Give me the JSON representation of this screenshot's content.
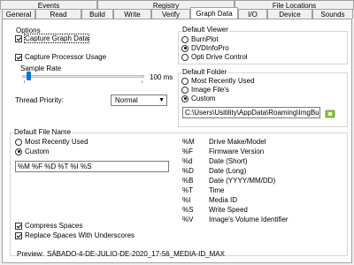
{
  "tabs_row1": [
    {
      "label": "Events"
    },
    {
      "label": "Registry"
    },
    {
      "label": "File Locations"
    }
  ],
  "tabs_row2": [
    {
      "label": "General"
    },
    {
      "label": "Read"
    },
    {
      "label": "Build"
    },
    {
      "label": "Write"
    },
    {
      "label": "Verify"
    },
    {
      "label": "Graph Data"
    },
    {
      "label": "I/O"
    },
    {
      "label": "Device"
    },
    {
      "label": "Sounds"
    }
  ],
  "options": {
    "title": "Options",
    "capture_graph_data": {
      "label": "Capture Graph Data",
      "checked": true
    },
    "capture_processor_usage": {
      "label": "Capture Processor Usage",
      "checked": true
    },
    "sample_rate_label": "Sample Rate",
    "sample_rate_value": "100 ms",
    "sample_rate_fraction": 0.04,
    "thread_priority_label": "Thread Priority:",
    "thread_priority_value": "Normal"
  },
  "default_viewer": {
    "title": "Default Viewer",
    "items": [
      {
        "label": "BurnPlot",
        "checked": false
      },
      {
        "label": "DVDInfoPro",
        "checked": true
      },
      {
        "label": "Opti Drive Control",
        "checked": false
      }
    ]
  },
  "default_folder": {
    "title": "Default Folder",
    "items": [
      {
        "label": "Most Recently Used",
        "checked": false
      },
      {
        "label": "Image File's",
        "checked": false
      },
      {
        "label": "Custom",
        "checked": true
      }
    ],
    "path": "C:\\Users\\Usitility\\AppData\\Roaming\\ImgBurn\\G"
  },
  "default_file_name": {
    "title": "Default File Name",
    "items": [
      {
        "label": "Most Recently Used",
        "checked": false
      },
      {
        "label": "Custom",
        "checked": true
      }
    ],
    "pattern": "%M %F %D %T %I %S"
  },
  "legend": [
    {
      "code": "%M",
      "desc": "Drive Make/Model"
    },
    {
      "code": "%F",
      "desc": "Firmware Version"
    },
    {
      "code": "%d",
      "desc": "Date (Short)"
    },
    {
      "code": "%D",
      "desc": "Date (Long)"
    },
    {
      "code": "%B",
      "desc": "Date (YYYY/MM/DD)"
    },
    {
      "code": "%T",
      "desc": "Time"
    },
    {
      "code": "%I",
      "desc": "Media ID"
    },
    {
      "code": "%S",
      "desc": "Write Speed"
    },
    {
      "code": "%V",
      "desc": "Image's Volume Identifier"
    }
  ],
  "compress_spaces": {
    "label": "Compress Spaces",
    "checked": true
  },
  "replace_spaces": {
    "label": "Replace Spaces With Underscores",
    "checked": true
  },
  "preview_label": "Preview:",
  "preview_value": "SÁBADO-4-DE-JULIO-DE-2020_17-56_MEDIA-ID_MAX",
  "colors": {
    "accent": "#0078d7",
    "folder_icon": "#8dc63f"
  }
}
